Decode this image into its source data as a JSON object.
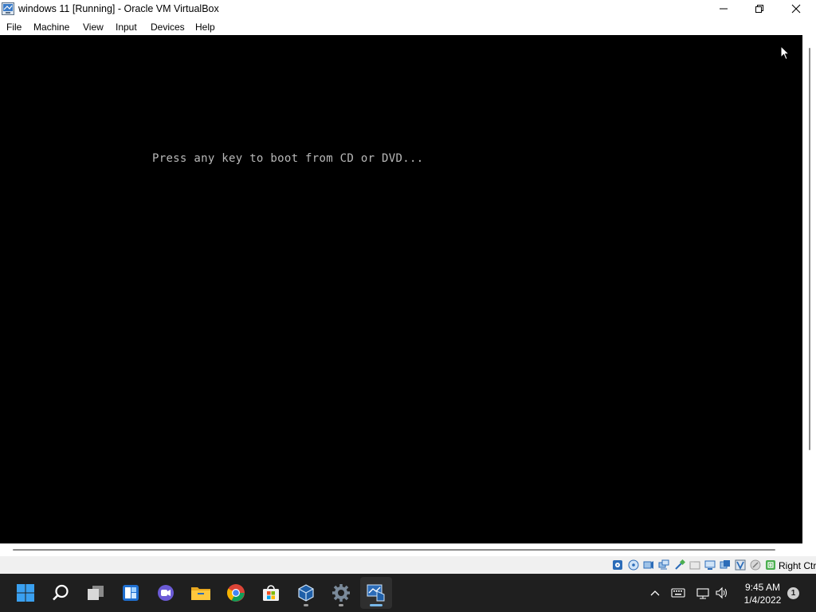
{
  "window": {
    "title": "windows 11 [Running] - Oracle VM VirtualBox",
    "controls": [
      "minimize-icon",
      "restore-icon",
      "close-icon"
    ]
  },
  "menu": {
    "file": "File",
    "machine": "Machine",
    "view": "View",
    "input": "Input",
    "devices": "Devices",
    "help": "Help"
  },
  "vm": {
    "screen_color": "#000000",
    "boot_message": "Press any key to boot from CD or DVD..."
  },
  "statusbar": {
    "icons": [
      "hard-disk-icon",
      "optical-drive-icon",
      "audio-icon",
      "network-icon",
      "usb-icon",
      "shared-folders-icon",
      "display-icon",
      "recording-icon",
      "virtualization-icon",
      "mouse-integration-icon",
      "keyboard-icon"
    ],
    "host_key": "Right Ctrl"
  },
  "taskbar": {
    "apps": [
      "start-icon",
      "search-icon",
      "task-view-icon",
      "widgets-icon",
      "chat-icon",
      "file-explorer-icon",
      "chrome-icon",
      "store-icon",
      "virtualbox-manager-icon",
      "settings-icon",
      "virtualbox-vm-icon"
    ],
    "tray": [
      "show-hidden-icons-icon",
      "keyboard-layout-icon",
      "network-icon",
      "volume-icon"
    ],
    "time": "9:45 AM",
    "date": "1/4/2022",
    "notification_count": "1"
  }
}
